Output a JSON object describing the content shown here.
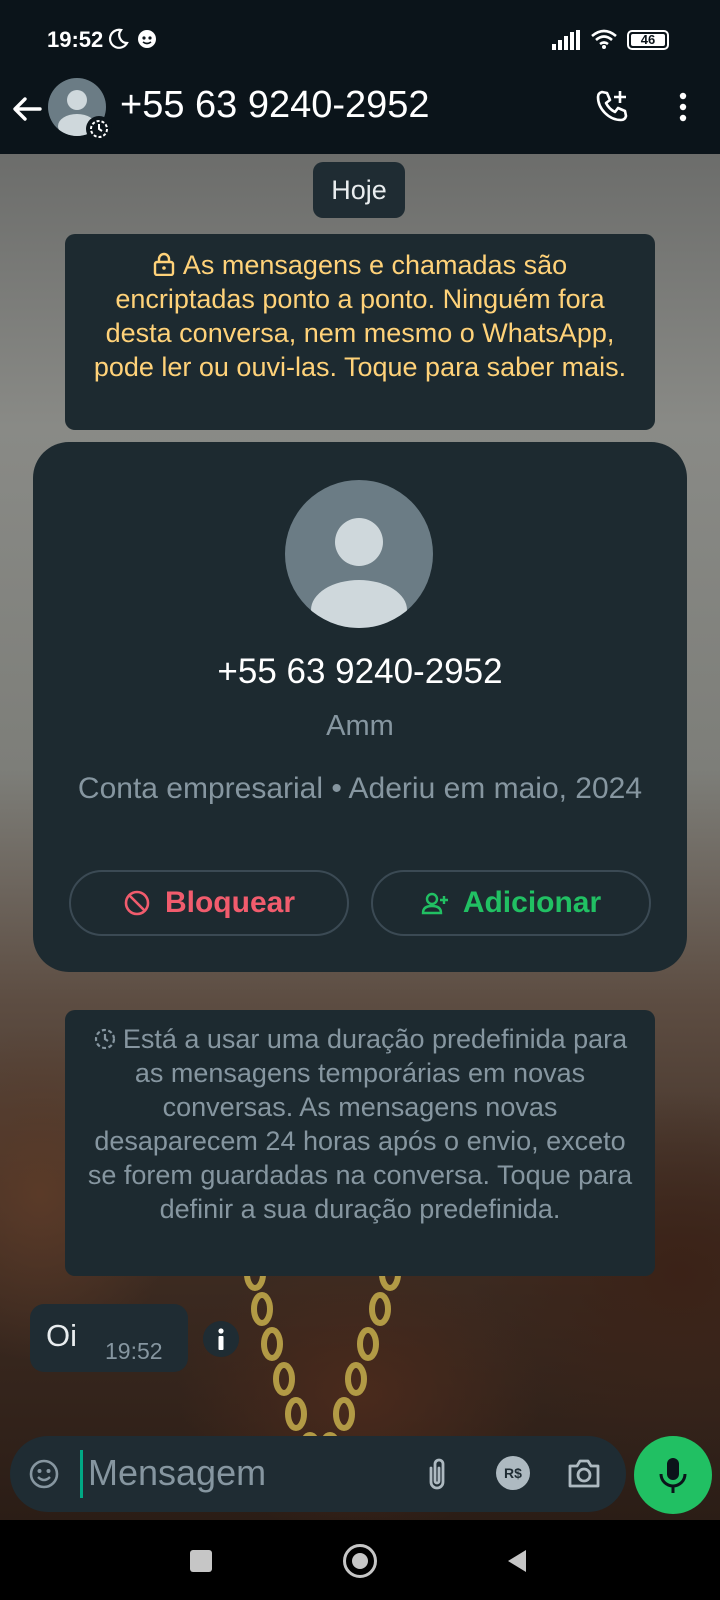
{
  "status_bar": {
    "time": "19:52",
    "battery": "46"
  },
  "header": {
    "title": "+55 63 9240-2952"
  },
  "chat": {
    "date_chip": "Hoje",
    "encryption_notice": "As mensagens e chamadas são encriptadas ponto a ponto. Ninguém fora desta conversa, nem mesmo o WhatsApp, pode ler ou ouvi-las. Toque para saber mais.",
    "contact_card": {
      "number": "+55 63 9240-2952",
      "name": "Amm",
      "info": "Conta empresarial • Aderiu em maio, 2024",
      "block_label": "Bloquear",
      "add_label": "Adicionar"
    },
    "disappearing_notice": "Está a usar uma duração predefinida para as mensagens temporárias em novas conversas. As mensagens novas desaparecem 24 horas após o envio, exceto se forem guardadas na conversa. Toque para definir a sua duração predefinida.",
    "messages": [
      {
        "text": "Oi",
        "time": "19:52"
      }
    ]
  },
  "input": {
    "placeholder": "Mensagem",
    "pay_label": "R$"
  },
  "colors": {
    "accent_green": "#21c063",
    "danger_red": "#f15c6d",
    "notice_yellow": "#ffd279",
    "bubble": "#1f2c33"
  }
}
